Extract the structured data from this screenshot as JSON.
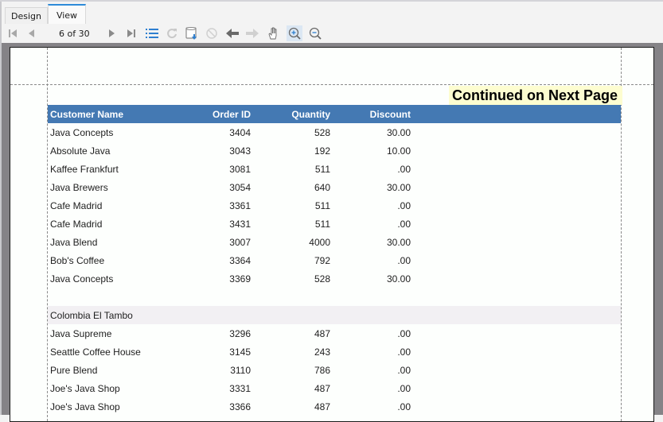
{
  "tabs": [
    {
      "label": "Design",
      "active": false
    },
    {
      "label": "View",
      "active": true
    }
  ],
  "toolbar": {
    "page_indicator": "6 of 30",
    "buttons": [
      {
        "name": "first-page",
        "icon": "first-page-icon",
        "enabled": false
      },
      {
        "name": "previous-page",
        "icon": "previous-page-icon",
        "enabled": false
      },
      {
        "name": "next-page",
        "icon": "next-page-icon",
        "enabled": true
      },
      {
        "name": "last-page",
        "icon": "last-page-icon",
        "enabled": true
      },
      {
        "name": "toc",
        "icon": "list-icon",
        "enabled": true
      },
      {
        "name": "refresh",
        "icon": "refresh-icon",
        "enabled": false
      },
      {
        "name": "export",
        "icon": "export-icon",
        "enabled": true
      },
      {
        "name": "stop",
        "icon": "stop-icon",
        "enabled": false
      },
      {
        "name": "back",
        "icon": "back-arrow-icon",
        "enabled": true
      },
      {
        "name": "forward",
        "icon": "forward-arrow-icon",
        "enabled": false
      },
      {
        "name": "pan",
        "icon": "hand-icon",
        "enabled": true
      },
      {
        "name": "zoom-in",
        "icon": "zoom-in-icon",
        "enabled": true,
        "active": true
      },
      {
        "name": "zoom-out",
        "icon": "zoom-out-icon",
        "enabled": true
      }
    ]
  },
  "report": {
    "continued_label": "Continued on Next Page",
    "columns": [
      "Customer Name",
      "Order ID",
      "Quantity",
      "Discount"
    ],
    "rows": [
      {
        "type": "data",
        "name": "Java Concepts",
        "order_id": "3404",
        "quantity": "528",
        "discount": "30.00"
      },
      {
        "type": "data",
        "name": "Absolute Java",
        "order_id": "3043",
        "quantity": "192",
        "discount": "10.00"
      },
      {
        "type": "data",
        "name": "Kaffee Frankfurt",
        "order_id": "3081",
        "quantity": "511",
        "discount": ".00"
      },
      {
        "type": "data",
        "name": "Java Brewers",
        "order_id": "3054",
        "quantity": "640",
        "discount": "30.00"
      },
      {
        "type": "data",
        "name": "Cafe Madrid",
        "order_id": "3361",
        "quantity": "511",
        "discount": ".00"
      },
      {
        "type": "data",
        "name": "Cafe Madrid",
        "order_id": "3431",
        "quantity": "511",
        "discount": ".00"
      },
      {
        "type": "data",
        "name": "Java Blend",
        "order_id": "3007",
        "quantity": "4000",
        "discount": "30.00"
      },
      {
        "type": "data",
        "name": "Bob's Coffee",
        "order_id": "3364",
        "quantity": "792",
        "discount": ".00"
      },
      {
        "type": "data",
        "name": "Java Concepts",
        "order_id": "3369",
        "quantity": "528",
        "discount": "30.00"
      },
      {
        "type": "spacer"
      },
      {
        "type": "group",
        "name": "Colombia El Tambo"
      },
      {
        "type": "data",
        "name": "Java Supreme",
        "order_id": "3296",
        "quantity": "487",
        "discount": ".00"
      },
      {
        "type": "data",
        "name": "Seattle Coffee House",
        "order_id": "3145",
        "quantity": "243",
        "discount": ".00"
      },
      {
        "type": "data",
        "name": "Pure Blend",
        "order_id": "3110",
        "quantity": "786",
        "discount": ".00"
      },
      {
        "type": "data",
        "name": "Joe's Java Shop",
        "order_id": "3331",
        "quantity": "487",
        "discount": ".00"
      },
      {
        "type": "data",
        "name": "Joe's Java Shop",
        "order_id": "3366",
        "quantity": "487",
        "discount": ".00"
      }
    ]
  },
  "colors": {
    "header_bg": "#4479b3",
    "group_bg": "#f2f0f3",
    "continued_bg": "#fdfdd0",
    "viewer_bg": "#858387",
    "accent": "#2e8ad8"
  }
}
